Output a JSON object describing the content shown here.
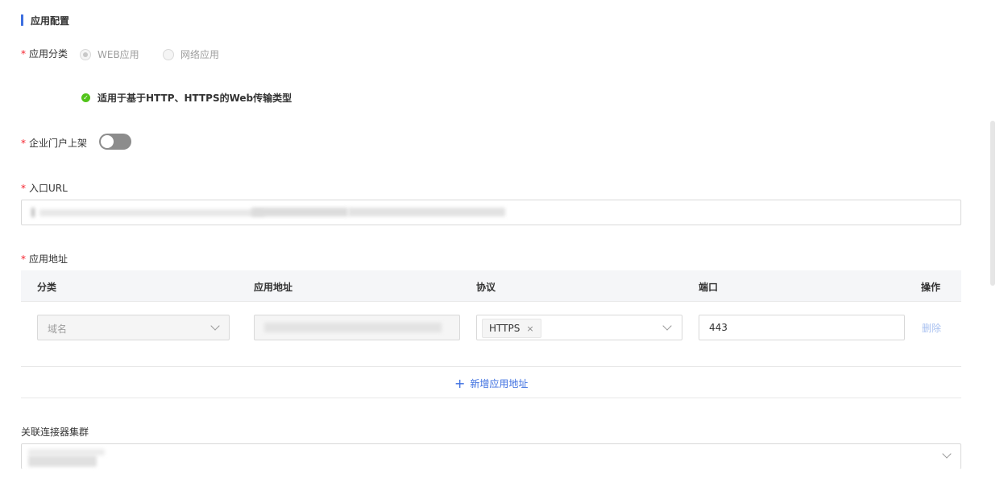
{
  "section": {
    "title": "应用配置"
  },
  "app_category": {
    "label": "应用分类",
    "options": [
      "WEB应用",
      "网络应用"
    ],
    "selected": "WEB应用",
    "tip": "适用于基于HTTP、HTTPS的Web传输类型"
  },
  "portal": {
    "label": "企业门户上架",
    "enabled": false
  },
  "entry_url": {
    "label": "入口URL"
  },
  "app_address": {
    "label": "应用地址",
    "columns": [
      "分类",
      "应用地址",
      "协议",
      "端口",
      "操作"
    ],
    "row": {
      "category": "域名",
      "protocol_tag": "HTTPS",
      "tag_remove": "×",
      "port": "443",
      "action": "删除"
    },
    "add_label": "新增应用地址",
    "add_icon": "+"
  },
  "connector_cluster": {
    "label": "关联连接器集群"
  },
  "colors": {
    "accent": "#3d6fe0",
    "success": "#52c41a",
    "required": "#f5222d",
    "link_disabled": "#a9c1f0"
  }
}
